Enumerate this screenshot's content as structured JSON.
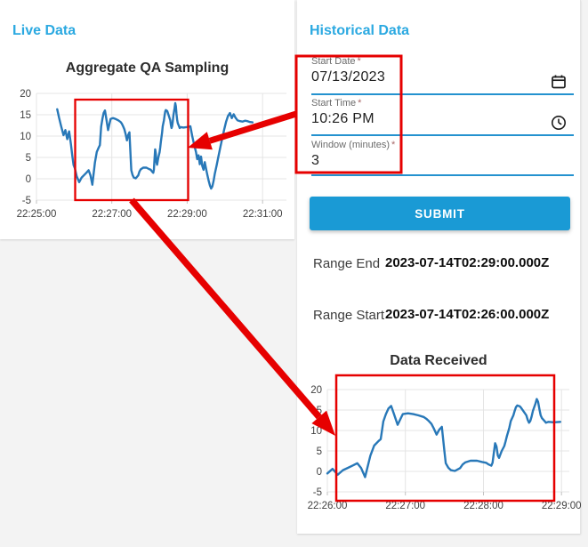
{
  "colors": {
    "header_accent": "#2ba9e1",
    "series_line": "#2878b8",
    "annotation_red": "#e60000",
    "field_underline": "#2492cf",
    "submit_bg": "#1a9ad5",
    "submit_text": "#ffffff"
  },
  "live_panel": {
    "title": "Live Data"
  },
  "historical_panel": {
    "title": "Historical Data",
    "form": {
      "fields": [
        {
          "label": "Start Date",
          "required": "*",
          "value": "07/13/2023",
          "icon": "calendar-icon"
        },
        {
          "label": "Start Time",
          "required": "*",
          "value": "10:26 PM",
          "icon": "clock-icon"
        },
        {
          "label": "Window (minutes)",
          "required": "*",
          "value": "3",
          "icon": ""
        }
      ],
      "submit_label": "SUBMIT"
    },
    "results": [
      {
        "label": "Range End",
        "value": "2023-07-14T02:29:00.000Z"
      },
      {
        "label": "Range Start",
        "value": "2023-07-14T02:26:00.000Z"
      }
    ]
  },
  "chart_data": [
    {
      "type": "line",
      "title": "Aggregate QA Sampling",
      "x_unit": "seconds after 22:25:00",
      "xlim": [
        0,
        398
      ],
      "ylim": [
        -5,
        20
      ],
      "grid": true,
      "legend": "none",
      "xticks": [
        {
          "t": 0,
          "label": "22:25:00"
        },
        {
          "t": 120,
          "label": "22:27:00"
        },
        {
          "t": 240,
          "label": "22:29:00"
        },
        {
          "t": 360,
          "label": "22:31:00"
        }
      ],
      "yticks": [
        20,
        15,
        10,
        5,
        0,
        -5
      ],
      "series": [
        {
          "name": "aggregate_qa",
          "points": [
            [
              33,
              16.3
            ],
            [
              36,
              14.3
            ],
            [
              39,
              12.5
            ],
            [
              43,
              10.2
            ],
            [
              46,
              11.4
            ],
            [
              49,
              9.3
            ],
            [
              52,
              11.1
            ],
            [
              55,
              8
            ],
            [
              57,
              5.5
            ],
            [
              59,
              3.2
            ],
            [
              61,
              2.5
            ],
            [
              64,
              0.6
            ],
            [
              68,
              -0.8
            ],
            [
              72,
              0.3
            ],
            [
              76,
              0.9
            ],
            [
              80,
              1.5
            ],
            [
              83,
              2
            ],
            [
              86,
              0.8
            ],
            [
              89,
              -1.4
            ],
            [
              93,
              3.8
            ],
            [
              96,
              6.3
            ],
            [
              99,
              7.3
            ],
            [
              101,
              7.9
            ],
            [
              103,
              12.2
            ],
            [
              105,
              14
            ],
            [
              107,
              15.4
            ],
            [
              109,
              16
            ],
            [
              111,
              14.2
            ],
            [
              114,
              11.4
            ],
            [
              116,
              12.7
            ],
            [
              118,
              14
            ],
            [
              122,
              14.2
            ],
            [
              126,
              14
            ],
            [
              130,
              13.7
            ],
            [
              134,
              13.3
            ],
            [
              136,
              12.9
            ],
            [
              138,
              12.3
            ],
            [
              140,
              11.6
            ],
            [
              142,
              10.4
            ],
            [
              144,
              9
            ],
            [
              146,
              10.2
            ],
            [
              148,
              10.9
            ],
            [
              150,
              4.9
            ],
            [
              151,
              2
            ],
            [
              153,
              0.9
            ],
            [
              155,
              0.3
            ],
            [
              158,
              0.1
            ],
            [
              162,
              0.8
            ],
            [
              164,
              1.7
            ],
            [
              166,
              2.2
            ],
            [
              170,
              2.6
            ],
            [
              175,
              2.6
            ],
            [
              179,
              2.3
            ],
            [
              182,
              2.1
            ],
            [
              184,
              1.7
            ],
            [
              186,
              1.4
            ],
            [
              187,
              2.1
            ],
            [
              188,
              4.6
            ],
            [
              189,
              6.9
            ],
            [
              190,
              6.1
            ],
            [
              191,
              3.9
            ],
            [
              192,
              3.3
            ],
            [
              194,
              5
            ],
            [
              196,
              6.2
            ],
            [
              197,
              7.3
            ],
            [
              198,
              8.6
            ],
            [
              199,
              9.7
            ],
            [
              200,
              10.8
            ],
            [
              201,
              12.3
            ],
            [
              203,
              13.7
            ],
            [
              204,
              14.8
            ],
            [
              205,
              15.7
            ],
            [
              206,
              16.1
            ],
            [
              208,
              15.9
            ],
            [
              209,
              15.5
            ],
            [
              211,
              14.6
            ],
            [
              213,
              13.7
            ],
            [
              214,
              12.6
            ],
            [
              215,
              11.9
            ],
            [
              216,
              12.3
            ],
            [
              217,
              13.4
            ],
            [
              218,
              14.8
            ],
            [
              220,
              16.6
            ],
            [
              221,
              17.7
            ],
            [
              222,
              17
            ],
            [
              223,
              15.2
            ],
            [
              224,
              13.7
            ],
            [
              225,
              13
            ],
            [
              227,
              12.3
            ],
            [
              228,
              11.9
            ],
            [
              230,
              12.1
            ],
            [
              234,
              12
            ],
            [
              239,
              12.1
            ],
            [
              245,
              12.3
            ],
            [
              248,
              10
            ],
            [
              251,
              8
            ],
            [
              254,
              6.3
            ],
            [
              256,
              4.6
            ],
            [
              258,
              5.5
            ],
            [
              260,
              3.4
            ],
            [
              262,
              5.2
            ],
            [
              264,
              3
            ],
            [
              266,
              2.1
            ],
            [
              268,
              3.9
            ],
            [
              270,
              2.4
            ],
            [
              272,
              1
            ],
            [
              274,
              -0.4
            ],
            [
              276,
              -1.5
            ],
            [
              278,
              -2.3
            ],
            [
              280,
              -1.8
            ],
            [
              282,
              -0.5
            ],
            [
              284,
              1.2
            ],
            [
              287,
              3.2
            ],
            [
              290,
              5.4
            ],
            [
              293,
              7.6
            ],
            [
              296,
              9.6
            ],
            [
              299,
              11.6
            ],
            [
              302,
              13.4
            ],
            [
              305,
              14.7
            ],
            [
              308,
              15.4
            ],
            [
              311,
              14.2
            ],
            [
              314,
              15.1
            ],
            [
              317,
              14.3
            ],
            [
              320,
              13.7
            ],
            [
              324,
              13.5
            ],
            [
              328,
              13.4
            ],
            [
              332,
              13.6
            ],
            [
              336,
              13.5
            ],
            [
              340,
              13.3
            ],
            [
              344,
              13.2
            ]
          ]
        }
      ]
    },
    {
      "type": "line",
      "title": "Data Received",
      "x_unit": "seconds after 22:26:00",
      "xlim": [
        0,
        186
      ],
      "ylim": [
        -5,
        20
      ],
      "grid": true,
      "legend": "none",
      "xticks": [
        {
          "t": 0,
          "label": "22:26:00"
        },
        {
          "t": 60,
          "label": "22:27:00"
        },
        {
          "t": 120,
          "label": "22:28:00"
        },
        {
          "t": 180,
          "label": "22:29:00"
        }
      ],
      "yticks": [
        20,
        15,
        10,
        5,
        0,
        -5
      ],
      "series": [
        {
          "name": "data_received",
          "points": [
            [
              0,
              -0.5
            ],
            [
              4,
              0.6
            ],
            [
              8,
              -0.8
            ],
            [
              12,
              0.3
            ],
            [
              16,
              0.9
            ],
            [
              20,
              1.5
            ],
            [
              23,
              2
            ],
            [
              26,
              0.8
            ],
            [
              29,
              -1.4
            ],
            [
              33,
              3.8
            ],
            [
              36,
              6.3
            ],
            [
              39,
              7.3
            ],
            [
              41,
              7.9
            ],
            [
              43,
              12.2
            ],
            [
              45,
              14
            ],
            [
              47,
              15.4
            ],
            [
              49,
              16
            ],
            [
              51,
              14.2
            ],
            [
              54,
              11.4
            ],
            [
              56,
              12.7
            ],
            [
              58,
              14
            ],
            [
              62,
              14.2
            ],
            [
              66,
              14
            ],
            [
              70,
              13.7
            ],
            [
              74,
              13.3
            ],
            [
              76,
              12.9
            ],
            [
              78,
              12.3
            ],
            [
              80,
              11.6
            ],
            [
              82,
              10.4
            ],
            [
              84,
              9
            ],
            [
              86,
              10.2
            ],
            [
              88,
              10.9
            ],
            [
              90,
              4.9
            ],
            [
              91,
              2
            ],
            [
              93,
              0.9
            ],
            [
              95,
              0.3
            ],
            [
              98,
              0.1
            ],
            [
              102,
              0.8
            ],
            [
              104,
              1.7
            ],
            [
              106,
              2.2
            ],
            [
              110,
              2.6
            ],
            [
              115,
              2.6
            ],
            [
              119,
              2.3
            ],
            [
              122,
              2.1
            ],
            [
              124,
              1.7
            ],
            [
              126,
              1.4
            ],
            [
              127,
              2.1
            ],
            [
              128,
              4.6
            ],
            [
              129,
              6.9
            ],
            [
              130,
              6.1
            ],
            [
              131,
              3.9
            ],
            [
              132,
              3.3
            ],
            [
              134,
              5
            ],
            [
              136,
              6.2
            ],
            [
              137,
              7.3
            ],
            [
              138,
              8.6
            ],
            [
              139,
              9.7
            ],
            [
              140,
              10.8
            ],
            [
              141,
              12.3
            ],
            [
              143,
              13.7
            ],
            [
              144,
              14.8
            ],
            [
              145,
              15.7
            ],
            [
              146,
              16.1
            ],
            [
              148,
              15.9
            ],
            [
              149,
              15.5
            ],
            [
              151,
              14.6
            ],
            [
              153,
              13.7
            ],
            [
              154,
              12.6
            ],
            [
              155,
              11.9
            ],
            [
              156,
              12.3
            ],
            [
              157,
              13.4
            ],
            [
              158,
              14.8
            ],
            [
              160,
              16.6
            ],
            [
              161,
              17.7
            ],
            [
              162,
              17
            ],
            [
              163,
              15.2
            ],
            [
              164,
              13.7
            ],
            [
              165,
              13
            ],
            [
              167,
              12.3
            ],
            [
              168,
              11.9
            ],
            [
              170,
              12.1
            ],
            [
              174,
              12
            ],
            [
              179,
              12.1
            ]
          ]
        }
      ]
    }
  ]
}
